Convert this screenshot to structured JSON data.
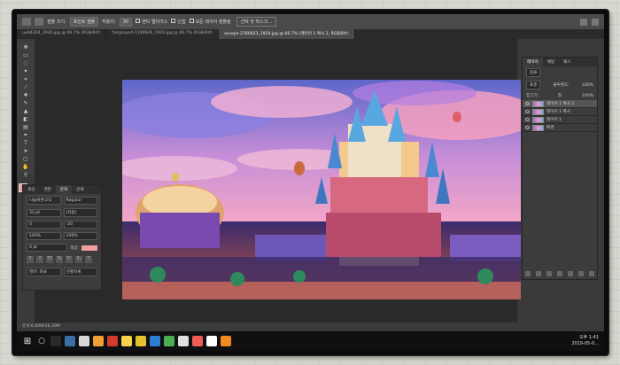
{
  "options_bar": {
    "select_label": "샘플 크기:",
    "select_value": "포인트 샘플",
    "sample_label": "표본:",
    "sample_value": "모든 레이어 샘플링",
    "tolerance_label": "허용치:",
    "tolerance_value": "30",
    "antialias_label": "앤티 앨리어스",
    "contiguous_label": "인접",
    "all_layers_label": "모든 레이어 샘플링",
    "refine_button": "선택 및 마스크..."
  },
  "tabs": [
    {
      "label": "uu94264_1920.jpg @ 66.7% (RGB/8#)",
      "active": false
    },
    {
      "label": "fairground-1149826_1920.jpg @ 66.7% (RGB/8#)",
      "active": false
    },
    {
      "label": "europe-2780933_1920.jpg @ 66.7% (레이어 1 복사 2, RGB/8#)",
      "active": true
    }
  ],
  "character_panel": {
    "tabs": [
      "색상",
      "견본",
      "문자",
      "단락"
    ],
    "active_tab": "문자",
    "font_family": "나눔바른고딕",
    "font_style": "Regular",
    "font_size": "33 pt",
    "leading": "(자동)",
    "tracking": "-20",
    "kerning": "0",
    "vert_scale": "100%",
    "horiz_scale": "100%",
    "baseline": "0 pt",
    "color_label": "색상:",
    "language": "영어: 미국",
    "aa": "선명하게"
  },
  "layers_panel": {
    "tabs": [
      "레이어",
      "채널",
      "패스"
    ],
    "kind": "종류",
    "blend": "표준",
    "opacity_label": "불투명도:",
    "opacity": "100%",
    "lock_label": "잠그기:",
    "fill_label": "칠:",
    "fill": "100%",
    "layers": [
      {
        "name": "레이어 1 복사 2",
        "selected": true
      },
      {
        "name": "레이어 1 복사",
        "selected": false
      },
      {
        "name": "레이어 1",
        "selected": false
      },
      {
        "name": "배경",
        "selected": false
      }
    ]
  },
  "status": {
    "text": "문서:6.60M/26.39M"
  },
  "taskbar": {
    "time": "오후 1:41",
    "date": "2019-05-0..."
  },
  "colors": {
    "foreground": "#f0a09a",
    "background": "#ffffff"
  }
}
